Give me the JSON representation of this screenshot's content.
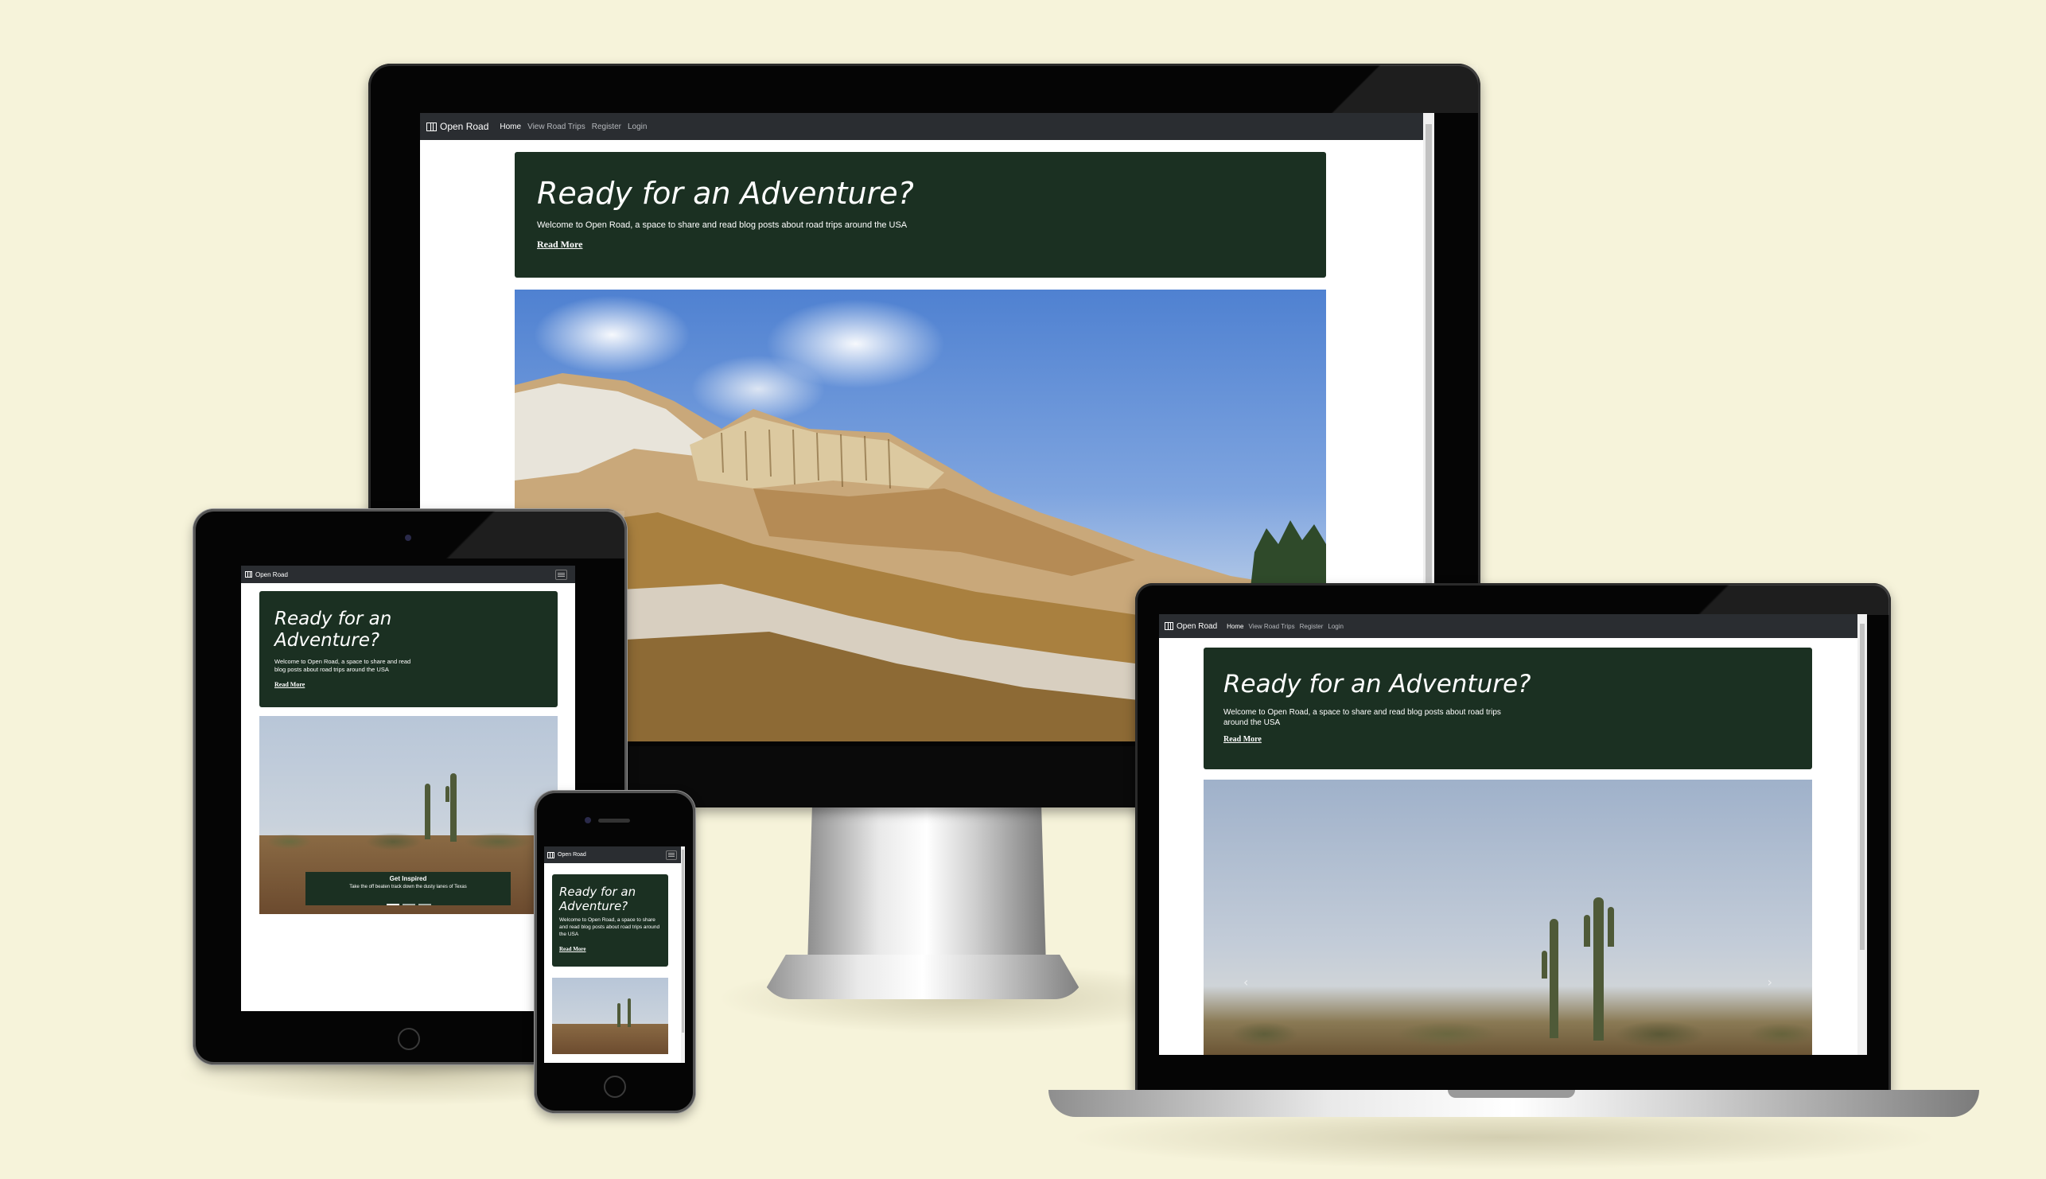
{
  "site": {
    "brand": "Open Road",
    "nav": [
      "Home",
      "View Road Trips",
      "Register",
      "Login"
    ],
    "hero_title": "Ready for an Adventure?",
    "hero_text": "Welcome to Open Road, a space to share and read blog posts about road trips around the USA",
    "hero_link": "Read More",
    "carousel_caption_title": "Get Inspired",
    "carousel_caption_text": "Take the off beaten track down the dusty lanes of Texas"
  },
  "colors": {
    "background": "#f6f3da",
    "navbar": "#2a2d31",
    "hero": "#1b3022",
    "sky": "#5b8bd6"
  },
  "icons": {
    "brand": "map-icon",
    "menu": "hamburger-icon"
  }
}
